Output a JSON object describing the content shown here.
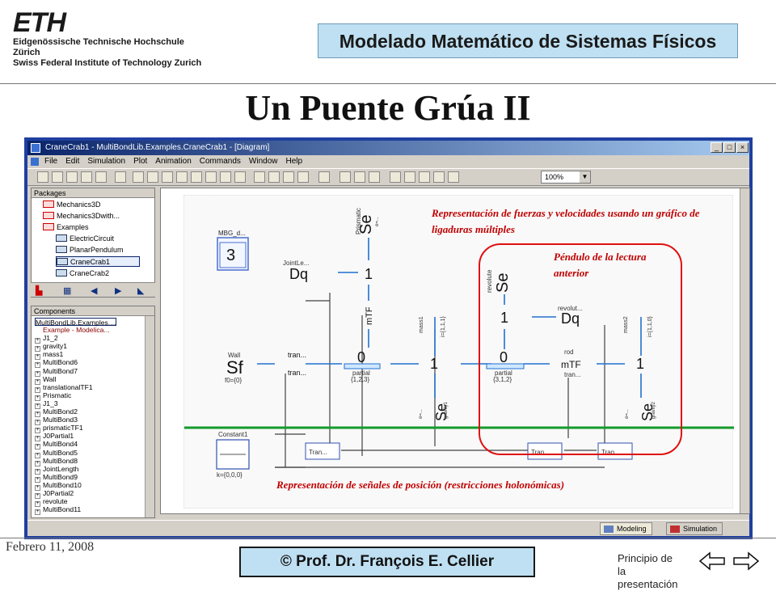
{
  "header": {
    "eth_mark": "ETH",
    "eth_line1": "Eidgenössische Technische Hochschule Zürich",
    "eth_line2": "Swiss Federal Institute of Technology Zurich",
    "course": "Modelado Matemático de Sistemas Físicos"
  },
  "slide_title": "Un Puente Grúa II",
  "window": {
    "title": "CraneCrab1 - MultiBondLib.Examples.CraneCrab1 - [Diagram]",
    "menu": [
      "File",
      "Edit",
      "Simulation",
      "Plot",
      "Animation",
      "Commands",
      "Window",
      "Help"
    ],
    "zoom": "100%",
    "tabs": [
      "Modeling",
      "Simulation"
    ]
  },
  "packages": {
    "header": "Packages",
    "items": [
      "Mechanics3D",
      "Mechanics3Dwith...",
      "Examples",
      "ElectricCircuit",
      "PlanarPendulum",
      "CraneCrab1",
      "CraneCrab2"
    ],
    "selected": "CraneCrab1"
  },
  "components": {
    "header": "Components",
    "root": "MultiBondLib.Examples....",
    "items": [
      "Example - Modelica...",
      "J1_2",
      "gravity1",
      "mass1",
      "MultiBond6",
      "MultiBond7",
      "Wall",
      "translationalTF1",
      "Prismatic",
      "J1_3",
      "MultiBond2",
      "MultiBond3",
      "prismaticTF1",
      "J0Partial1",
      "MultiBond4",
      "MultiBond5",
      "MultiBond8",
      "JointLength",
      "MultiBond9",
      "MultiBond10",
      "J0Partial2",
      "revolute",
      "MultiBond11"
    ]
  },
  "diagram": {
    "mbg_label": "MBG_d...",
    "mbg_num": "3",
    "sf": "Sf",
    "wall_label": "Wall",
    "sf_param": "f0={0}",
    "se": "Se",
    "one": "1",
    "zero": "0",
    "dq": "Dq",
    "mtf": "mTF",
    "joint_label": "JointLe...",
    "revolute_label": "revolut...",
    "prismatic_label": "Prismatic",
    "revolute_v": "revolute",
    "mass1_label": "mass1",
    "mass2_label": "mass2",
    "mass1_param": "i={1,1,1}",
    "mass2_param": "i={1,1,0}",
    "tran_label": "tran...",
    "tran_block": "Tran...",
    "partial_label": "partial",
    "partial1_param": "{1,2,3}",
    "partial2_param": "{3,1,2}",
    "rod_label": "rod",
    "constant_label": "Constant1",
    "constant_param": "k={0,0,0}",
    "gravity1": "gravity1",
    "gravity2": "gravity2",
    "e_eq": "e=..."
  },
  "annotations": {
    "forces": "Representación de fuerzas y velocidades usando un gráfico de ligaduras múltiples",
    "pendulum": "Péndulo de la lectura anterior",
    "signals": "Representación de señales de posición (restricciones holonómicas)"
  },
  "colors": {
    "annotation": "#c00000",
    "divider": "#159a2a",
    "highlight_border": "#e01010",
    "wire": "#404040",
    "bond": "#2070d0"
  },
  "footer": {
    "date": "Febrero 11, 2008",
    "copyright": "© Prof. Dr. François E. Cellier",
    "start_link": "Principio de la presentación"
  }
}
